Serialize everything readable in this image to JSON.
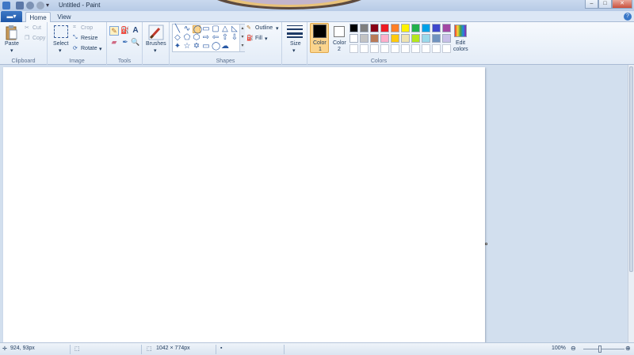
{
  "window": {
    "title": "Untitled - Paint",
    "controls": {
      "minimize": "–",
      "maximize": "□",
      "close": "✕"
    }
  },
  "quick_access": [
    "save-icon",
    "undo-icon",
    "redo-icon",
    "customize-icon"
  ],
  "tabs": {
    "file_label": "▬▾",
    "items": [
      {
        "label": "Home",
        "active": true
      },
      {
        "label": "View",
        "active": false
      }
    ],
    "help": "?"
  },
  "ribbon": {
    "clipboard": {
      "label": "Clipboard",
      "paste": "Paste",
      "cut": "Cut",
      "copy": "Copy"
    },
    "image": {
      "label": "Image",
      "select": "Select",
      "crop": "Crop",
      "resize": "Resize",
      "rotate": "Rotate"
    },
    "tools": {
      "label": "Tools"
    },
    "brushes": {
      "label": "Brushes"
    },
    "shapes": {
      "label": "Shapes",
      "outline": "Outline",
      "fill": "Fill",
      "glyphs": [
        "╲",
        "∿",
        "◯",
        "▭",
        "▢",
        "△",
        "◺",
        "◇",
        "⬠",
        "⬡",
        "⇨",
        "⇦",
        "⇧",
        "⇩",
        "✦",
        "☆",
        "✡",
        "▭",
        "◯",
        "☁"
      ]
    },
    "size": {
      "label": "Size"
    },
    "colors": {
      "label": "Colors",
      "color1_line1": "Color",
      "color1_line2": "1",
      "color2_line1": "Color",
      "color2_line2": "2",
      "edit_line1": "Edit",
      "edit_line2": "colors",
      "color1": "#000000",
      "color2": "#ffffff",
      "palette_row1": [
        "#000000",
        "#7f7f7f",
        "#880015",
        "#ed1c24",
        "#ff7f27",
        "#fff200",
        "#22b14c",
        "#00a2e8",
        "#3f48cc",
        "#a349a4"
      ],
      "palette_row2": [
        "#ffffff",
        "#c3c3c3",
        "#b97a57",
        "#ffaec9",
        "#ffc90e",
        "#efe4b0",
        "#b5e61d",
        "#99d9ea",
        "#7092be",
        "#c8bfe7"
      ]
    }
  },
  "status": {
    "cursor": "924, 93px",
    "image_size": "1042 × 774px",
    "zoom": "100%"
  }
}
